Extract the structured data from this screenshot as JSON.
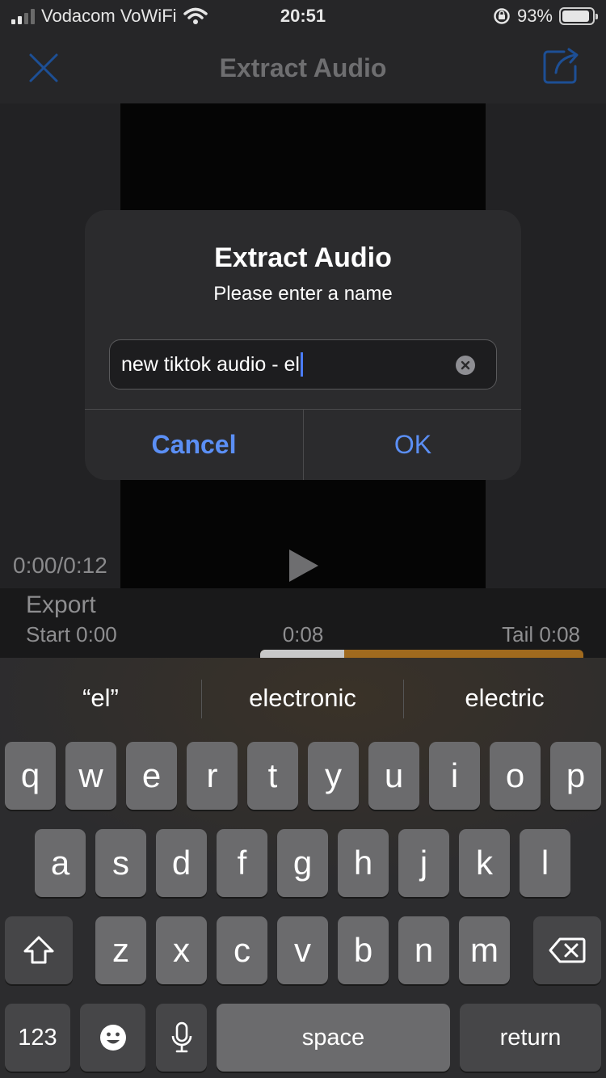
{
  "status": {
    "carrier": "Vodacom VoWiFi",
    "time": "20:51",
    "battery": "93%"
  },
  "nav": {
    "title": "Extract Audio"
  },
  "player": {
    "time": "0:00/0:12"
  },
  "trim": {
    "export": "Export",
    "start": "Start 0:00",
    "mid": "0:08",
    "tail": "Tail 0:08"
  },
  "dialog": {
    "title": "Extract Audio",
    "message": "Please enter a name",
    "input_value": "new tiktok audio - el",
    "cancel": "Cancel",
    "ok": "OK"
  },
  "keyboard": {
    "suggestions": [
      "“el”",
      "electronic",
      "electric"
    ],
    "row1": [
      "q",
      "w",
      "e",
      "r",
      "t",
      "y",
      "u",
      "i",
      "o",
      "p"
    ],
    "row2": [
      "a",
      "s",
      "d",
      "f",
      "g",
      "h",
      "j",
      "k",
      "l"
    ],
    "row3": [
      "z",
      "x",
      "c",
      "v",
      "b",
      "n",
      "m"
    ],
    "numbers": "123",
    "space": "space",
    "return": "return"
  }
}
